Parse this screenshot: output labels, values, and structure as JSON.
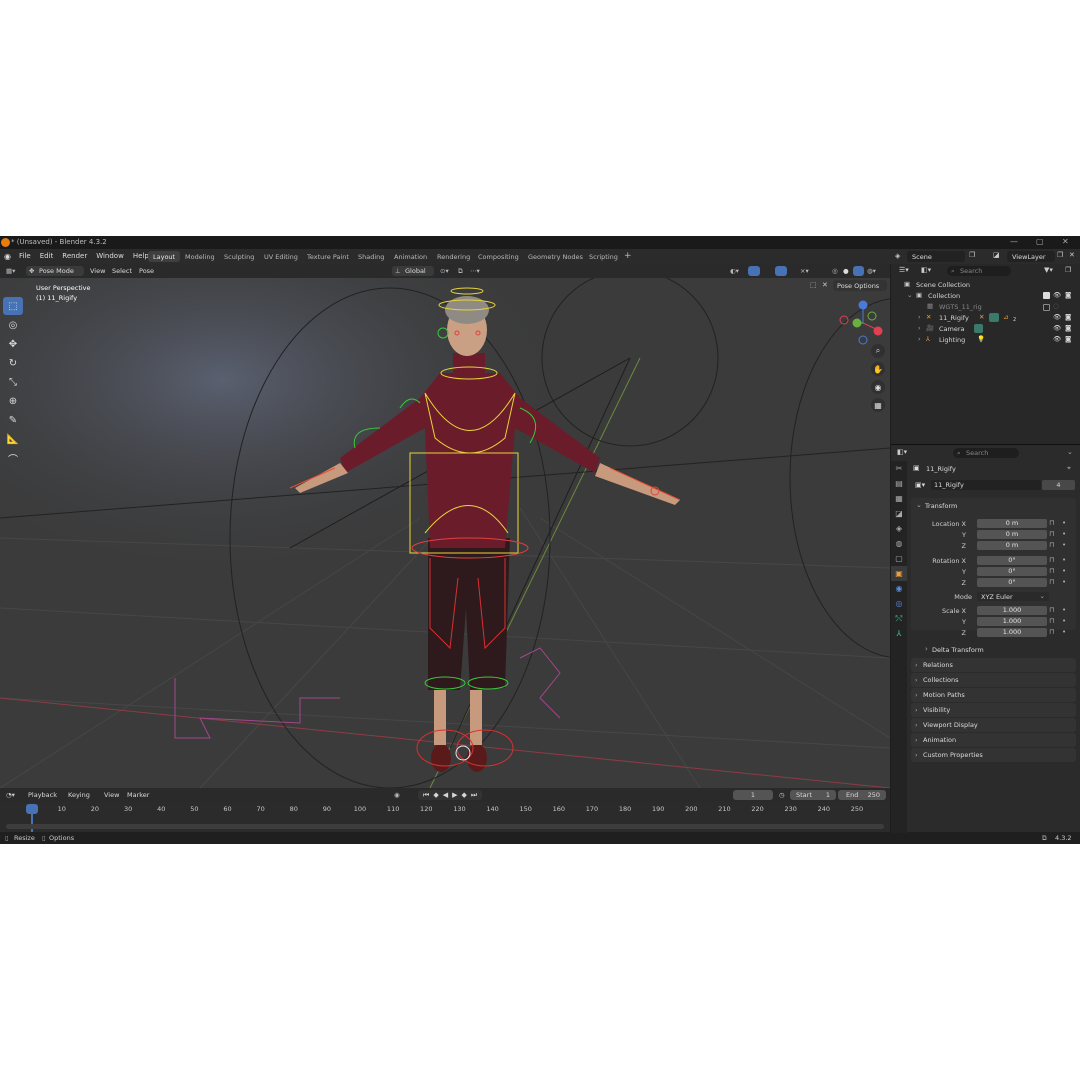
{
  "window": {
    "title": "* (Unsaved) - Blender 4.3.2"
  },
  "menu": [
    "File",
    "Edit",
    "Render",
    "Window",
    "Help"
  ],
  "workspaces": [
    "Layout",
    "Modeling",
    "Sculpting",
    "UV Editing",
    "Texture Paint",
    "Shading",
    "Animation",
    "Rendering",
    "Compositing",
    "Geometry Nodes",
    "Scripting"
  ],
  "active_workspace": "Layout",
  "scene": {
    "label": "Scene",
    "view_layer": "ViewLayer"
  },
  "viewport_header": {
    "mode": "Pose Mode",
    "view": "View",
    "select": "Select",
    "pose": "Pose",
    "transform_orientation": "Global",
    "pose_options": "Pose Options"
  },
  "viewport": {
    "perspective": "User Perspective",
    "object": "(1) 11_Rigify"
  },
  "timeline": {
    "playback": "Playback",
    "keying": "Keying",
    "view": "View",
    "marker": "Marker",
    "current_frame": "1",
    "start_label": "Start",
    "start": "1",
    "end_label": "End",
    "end": "250",
    "ticks": [
      "1",
      "10",
      "20",
      "30",
      "40",
      "50",
      "60",
      "70",
      "80",
      "90",
      "100",
      "110",
      "120",
      "130",
      "140",
      "150",
      "160",
      "170",
      "180",
      "190",
      "200",
      "210",
      "220",
      "230",
      "240",
      "250"
    ]
  },
  "status": {
    "resize": "Resize",
    "options": "Options",
    "version": "4.3.2"
  },
  "outliner": {
    "search_placeholder": "Search",
    "items": [
      "Scene Collection",
      "Collection",
      "WGTS_11_rig",
      "11_Rigify",
      "Camera",
      "Lighting"
    ],
    "badge": "2"
  },
  "properties": {
    "search_placeholder": "Search",
    "object_name": "11_Rigify",
    "datablock": "11_Rigify",
    "users": "4",
    "transform": {
      "title": "Transform",
      "location_label": "Location X",
      "y": "Y",
      "z": "Z",
      "location": [
        "0 m",
        "0 m",
        "0 m"
      ],
      "rotation_label": "Rotation X",
      "rotation": [
        "0°",
        "0°",
        "0°"
      ],
      "mode_label": "Mode",
      "mode": "XYZ Euler",
      "scale_label": "Scale X",
      "scale": [
        "1.000",
        "1.000",
        "1.000"
      ],
      "delta": "Delta Transform"
    },
    "sections": [
      "Relations",
      "Collections",
      "Motion Paths",
      "Visibility",
      "Viewport Display",
      "Animation",
      "Custom Properties"
    ]
  },
  "colors": {
    "accent": "#4772b3",
    "orange": "#e87d0d"
  }
}
